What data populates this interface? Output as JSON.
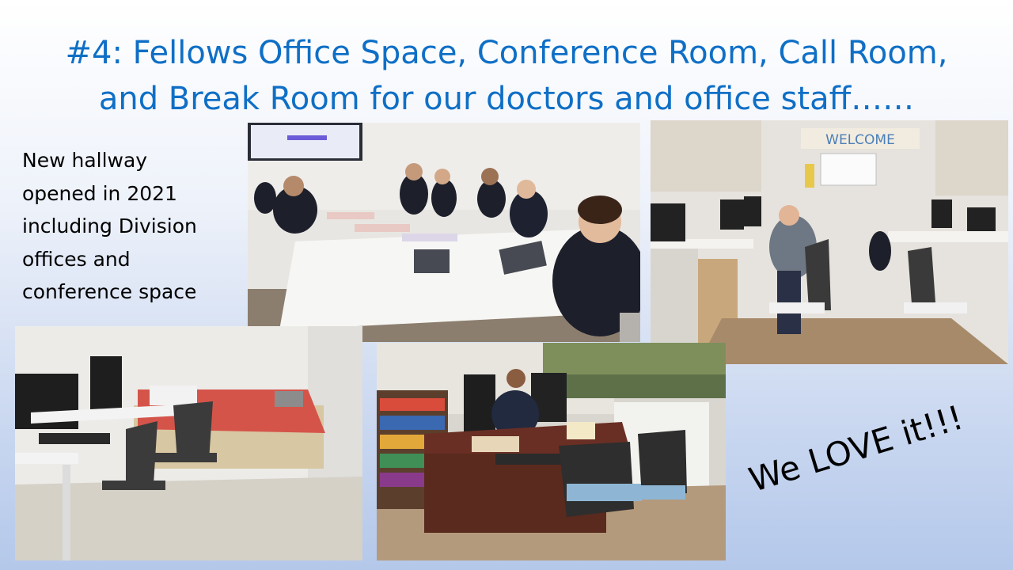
{
  "slide": {
    "title_line1": "#4: Fellows Office Space, Conference Room, Call Room,",
    "title_line2": "and Break Room for our doctors and office staff……",
    "side_text": [
      "New hallway",
      "opened in 2021",
      "including Division",
      "offices and",
      "conference space"
    ],
    "love_text": "We LOVE it!!!",
    "welcome_banner": "WELCOME"
  },
  "colors": {
    "title": "#0f6fc6",
    "scrubs": "#1d1f2b",
    "floor": "#a78a6a",
    "desk": "#5a2a1e",
    "blanket": "#d5544a"
  },
  "photos": [
    "conference-room-photo",
    "fellows-office-photo",
    "call-room-photo",
    "office-staff-photo"
  ]
}
